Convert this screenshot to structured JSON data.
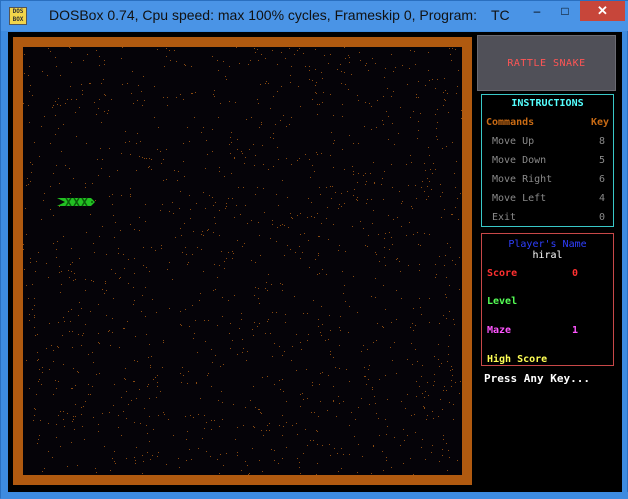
{
  "window": {
    "title": "DOSBox 0.74, Cpu speed: max 100% cycles, Frameskip  0, Program:",
    "program": "TC",
    "icon_label": "DOS BOX",
    "minimize": "–",
    "maximize": "□",
    "close": "✕"
  },
  "game": {
    "title": "RATTLE SNAKE",
    "instructions": {
      "heading": "INSTRUCTIONS",
      "col_commands": "Commands",
      "col_key": "Key",
      "rows": [
        {
          "command": "Move Up",
          "key": "8"
        },
        {
          "command": "Move Down",
          "key": "5"
        },
        {
          "command": "Move Right",
          "key": "6"
        },
        {
          "command": "Move Left",
          "key": "4"
        },
        {
          "command": "Exit",
          "key": "0"
        }
      ]
    },
    "info": {
      "player_label": "Player's Name",
      "player_name": "hiral",
      "score_label": "Score",
      "score_value": "0",
      "level_label": "Level",
      "maze_label": "Maze",
      "maze_value": "1",
      "high_score_label": "High Score"
    },
    "prompt": "Press Any Key...",
    "colors": {
      "border": "#b05a10",
      "field": "#050308",
      "snake": "#22c022",
      "dots": "#8a4a10",
      "title": "#ff5555",
      "instructions_border": "#39c8c8",
      "info_border": "#c84848",
      "player_label": "#2f3fff",
      "score": "#ff3030",
      "level": "#55ff55",
      "maze": "#ff55ff",
      "high_score": "#ffff55"
    },
    "snake_icon": "snake-sprite"
  }
}
